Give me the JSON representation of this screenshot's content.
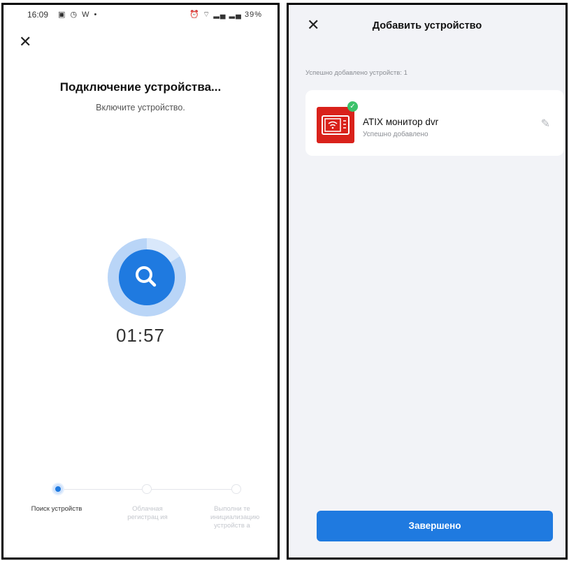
{
  "left_screen": {
    "status_bar": {
      "time": "16:09",
      "left_icons": "▣ ◷ W •",
      "right_icons": "⏰ ⌔ ▂▄ ▂▄ ",
      "battery": "39%"
    },
    "title": "Подключение устройства...",
    "subtitle": "Включите устройство.",
    "timer": "01:57",
    "steps": [
      {
        "label": "Поиск устройств",
        "active": true
      },
      {
        "label": "Облачная регистрац ия",
        "active": false
      },
      {
        "label": "Выполни те инициализацию устройств а",
        "active": false
      }
    ]
  },
  "right_screen": {
    "title": "Добавить устройство",
    "added_count_text": "Успешно добавлено устройств: 1",
    "device": {
      "name": "ATIX монитор dvr",
      "status": "Успешно добавлено"
    },
    "done_button": "Завершено"
  },
  "colors": {
    "accent": "#1f7ae0",
    "success": "#3cc26a",
    "device_red": "#d9221b"
  }
}
